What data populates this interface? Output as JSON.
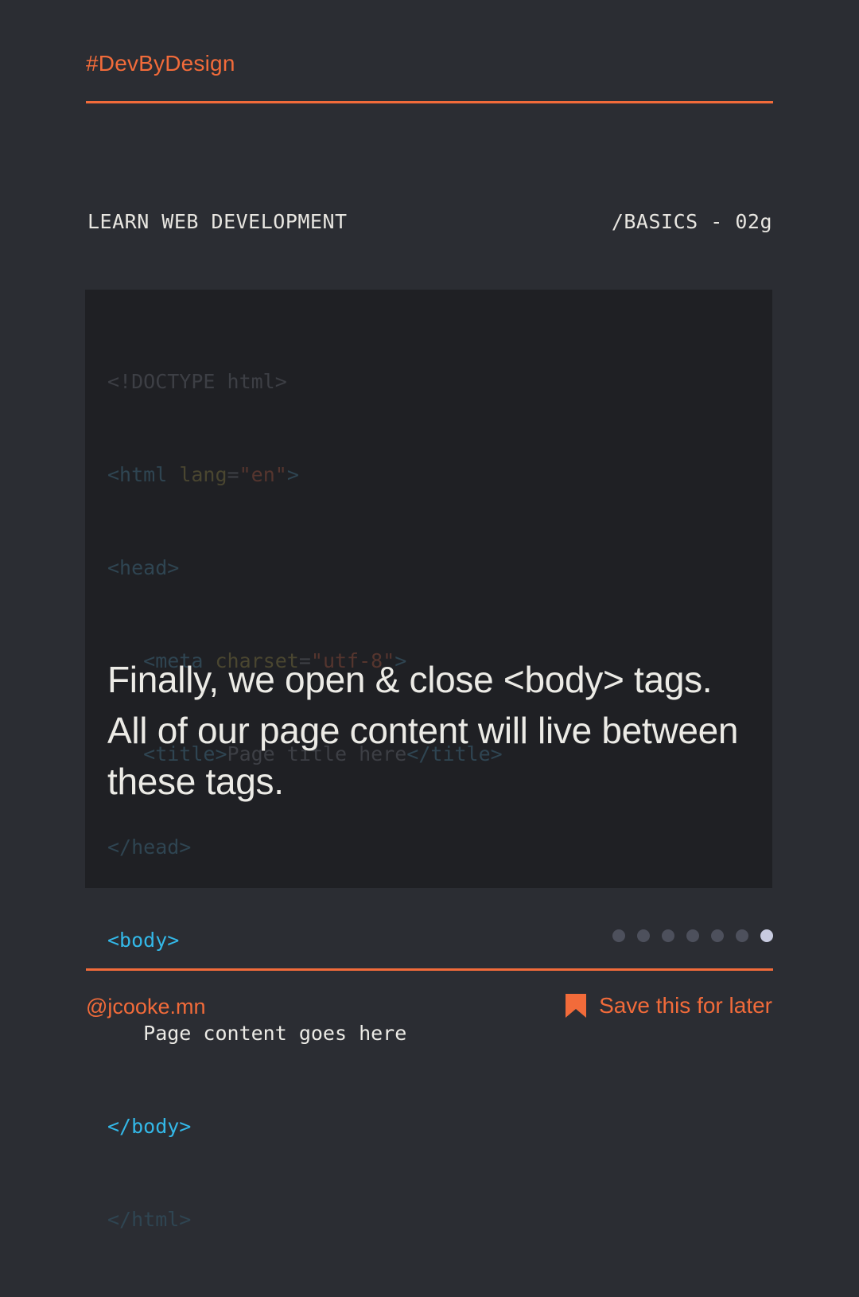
{
  "header": {
    "hashtag": "#DevByDesign"
  },
  "subheader": {
    "course": "LEARN WEB DEVELOPMENT",
    "lesson": "/BASICS - 02g"
  },
  "code": {
    "doctype": "<!DOCTYPE html>",
    "html_open_tag": "<html",
    "html_lang_attr": "lang",
    "eq": "=",
    "html_lang_value": "\"en\"",
    "html_open_close": ">",
    "head_open": "<head>",
    "meta_open_tag": "<meta",
    "meta_attr": "charset",
    "meta_value": "\"utf-8\"",
    "meta_close": ">",
    "title_open": "<title>",
    "title_text": "Page title here",
    "title_close": "</title>",
    "head_close": "</head>",
    "body_open": "<body>",
    "body_text": "Page content goes here",
    "body_close": "</body>",
    "html_close": "</html>"
  },
  "explanation": "Finally, we open & close <body> tags. All of our page content will live between these tags.",
  "pagination": {
    "total": 7,
    "current": 7
  },
  "footer": {
    "handle": "@jcooke.mn",
    "save_label": "Save this for later",
    "save_icon": "bookmark-icon"
  },
  "colors": {
    "background": "#2b2d33",
    "card": "#1f2024",
    "accent": "#f26b3a",
    "tag_highlight": "#33b8e8",
    "text": "#ecebe6"
  }
}
